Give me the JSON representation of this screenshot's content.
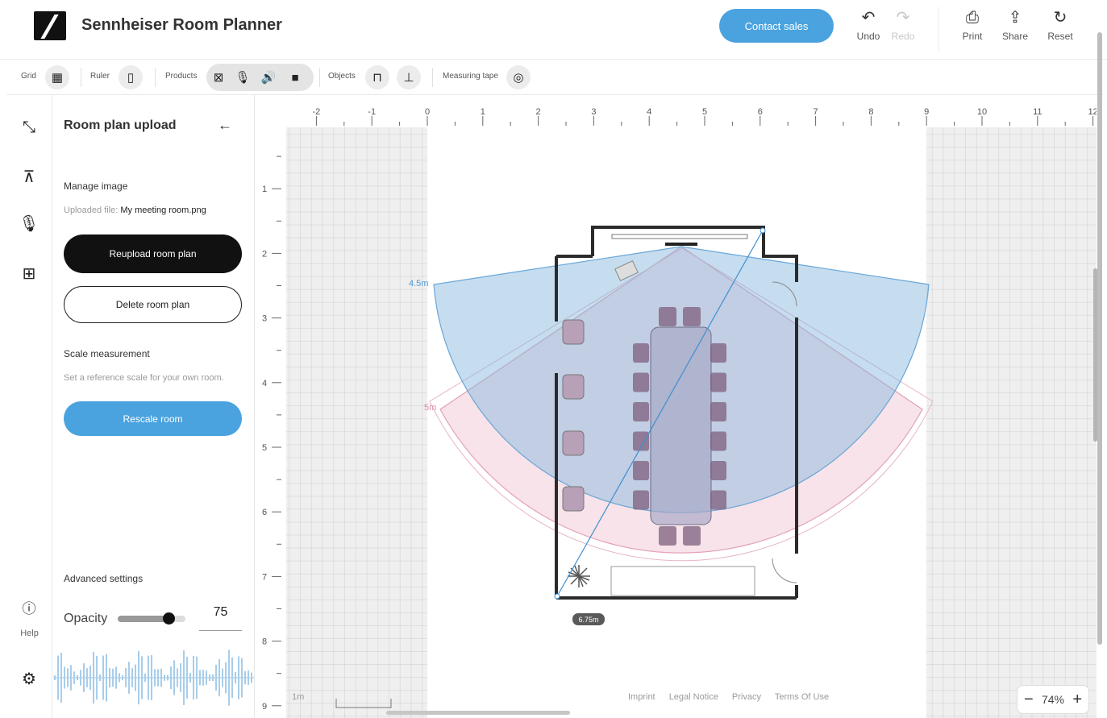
{
  "app": {
    "title": "Sennheiser Room Planner"
  },
  "header": {
    "contact_label": "Contact sales",
    "undo_label": "Undo",
    "redo_label": "Redo",
    "print_label": "Print",
    "share_label": "Share",
    "reset_label": "Reset"
  },
  "toolbar": {
    "grid_label": "Grid",
    "ruler_label": "Ruler",
    "products_label": "Products",
    "objects_label": "Objects",
    "measuring_label": "Measuring tape"
  },
  "rail": {
    "help_label": "Help"
  },
  "panel": {
    "title": "Room plan upload",
    "manage_label": "Manage image",
    "uploaded_prefix": "Uploaded file:",
    "uploaded_file": "My meeting room.png",
    "reupload_label": "Reupload room plan",
    "delete_label": "Delete room plan",
    "scale_label": "Scale measurement",
    "scale_hint": "Set a reference scale for your own room.",
    "rescale_label": "Rescale room",
    "advanced_label": "Advanced settings",
    "opacity_label": "Opacity",
    "opacity_value": "75",
    "opacity_fraction": 0.75
  },
  "canvas": {
    "ruler_x": [
      "-2",
      "-1",
      "0",
      "1",
      "2",
      "3",
      "4",
      "5",
      "6",
      "7",
      "8",
      "9",
      "10",
      "11",
      "12"
    ],
    "ruler_y": [
      "1",
      "2",
      "3",
      "4",
      "5",
      "6",
      "7",
      "8",
      "9"
    ],
    "coverage_blue_label": "4.5m",
    "coverage_pink_label": "5m",
    "measure_label": "6.75m",
    "scale_label": "1m",
    "zoom_label": "74%"
  },
  "footer": {
    "links": [
      "Imprint",
      "Legal Notice",
      "Privacy",
      "Terms Of Use"
    ]
  },
  "colors": {
    "accent": "#4aa3df",
    "coverage_blue": "#7fb3dc",
    "coverage_pink": "#e3a3b7",
    "wall": "#2b2b2b"
  }
}
